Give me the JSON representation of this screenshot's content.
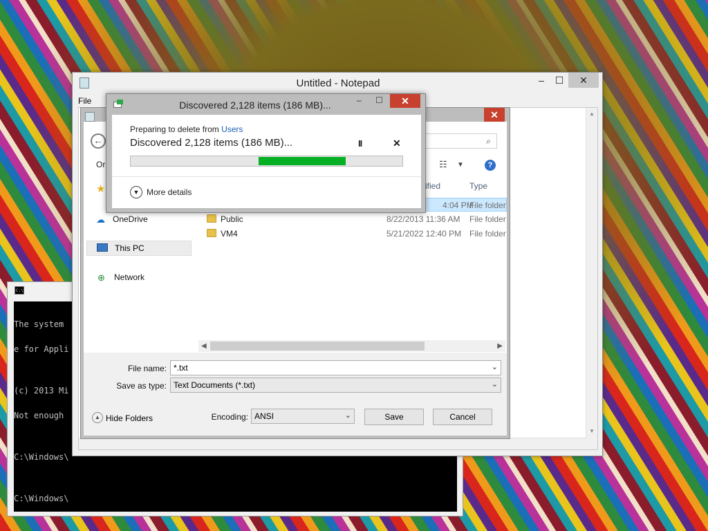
{
  "cmd": {
    "lines": [
      "The system",
      "e for Appli",
      "",
      "(c) 2013 Mi",
      "Not enough",
      "",
      "C:\\Windows\\",
      "",
      "C:\\Windows\\"
    ]
  },
  "notepad": {
    "title": "Untitled - Notepad",
    "menu_file": "File",
    "minimize": "–",
    "maximize": "☐",
    "close": "✕"
  },
  "saveas": {
    "close": "✕",
    "organize": "Or",
    "nav": {
      "onedrive": "OneDrive",
      "thispc": "This PC",
      "network": "Network"
    },
    "columns": {
      "date_modified": "ified",
      "type": "Type"
    },
    "rows": [
      {
        "name": "",
        "date": "4:04 PM",
        "type": "File folder"
      },
      {
        "name": "Public",
        "date": "8/22/2013 11:36 AM",
        "type": "File folder"
      },
      {
        "name": "VM4",
        "date": "5/21/2022 12:40 PM",
        "type": "File folder"
      }
    ],
    "file_name_label": "File name:",
    "file_name_value": "*.txt",
    "save_type_label": "Save as type:",
    "save_type_value": "Text Documents (*.txt)",
    "hide_folders": "Hide Folders",
    "encoding_label": "Encoding:",
    "encoding_value": "ANSI",
    "save_button": "Save",
    "cancel_button": "Cancel"
  },
  "progress": {
    "title": "Discovered 2,128 items (186 MB)...",
    "preparing": "Preparing to delete from ",
    "preparing_link": "Users",
    "status": "Discovered 2,128 items (186 MB)...",
    "minimize": "–",
    "maximize": "☐",
    "close": "✕",
    "pause": "II",
    "cancel": "✕",
    "more_details": "More details",
    "bar_fill_start_fraction": 0.47,
    "bar_fill_end_fraction": 0.79
  },
  "colors": {
    "progress_green": "#06b025",
    "close_red": "#c8402e",
    "link_blue": "#1a5fb4"
  }
}
